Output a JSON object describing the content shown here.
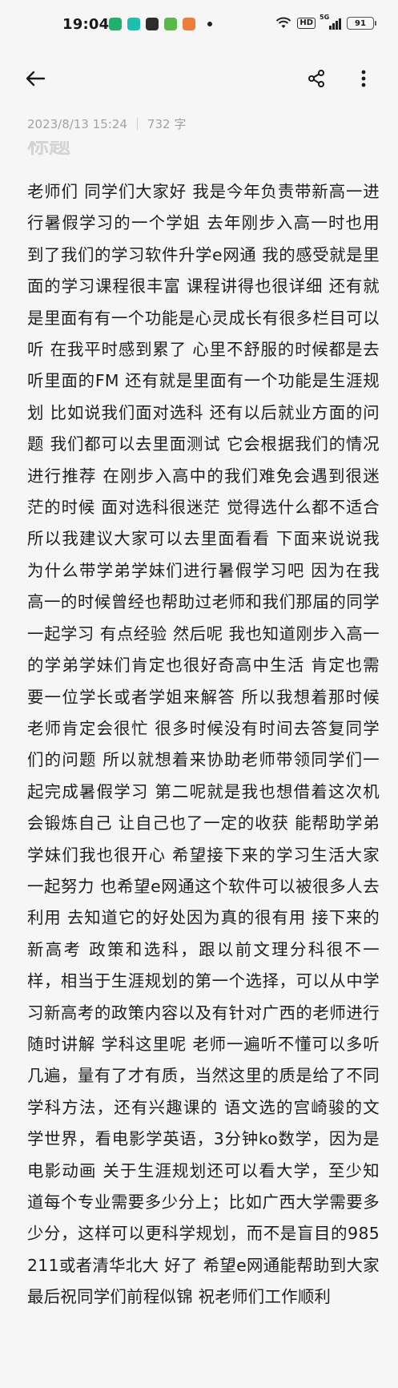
{
  "status_bar": {
    "time": "19:04",
    "signal_label": "5G",
    "hd_label": "HD",
    "battery": "91",
    "app_icon_colors": [
      "#22b06a",
      "#1fbfb0",
      "#2d2d2d",
      "#58b947",
      "#ef7d3a"
    ]
  },
  "toolbar": {
    "back_icon": "arrow-left-icon",
    "share_icon": "share-icon",
    "more_icon": "more-vertical-icon"
  },
  "note": {
    "datetime": "2023/8/13 15:24",
    "word_count": "732 字",
    "title": "标题",
    "body": "老师们 同学们大家好 我是今年负责带新高一进行暑假学习的一个学姐 去年刚步入高一时也用到了我们的学习软件升学e网通 我的感受就是里面的学习课程很丰富 课程讲得也很详细 还有就是里面有有一个功能是心灵成长有很多栏目可以听 在我平时感到累了 心里不舒服的时候都是去听里面的FM 还有就是里面有一个功能是生涯规划 比如说我们面对选科 还有以后就业方面的问题 我们都可以去里面测试 它会根据我们的情况进行推荐 在刚步入高中的我们难免会遇到很迷茫的时候 面对选科很迷茫 觉得选什么都不适合 所以我建议大家可以去里面看看 下面来说说我为什么带学弟学妹们进行暑假学习吧 因为在我高一的时候曾经也帮助过老师和我们那届的同学一起学习 有点经验 然后呢 我也知道刚步入高一的学弟学妹们肯定也很好奇高中生活 肯定也需要一位学长或者学姐来解答 所以我想着那时候老师肯定会很忙 很多时候没有时间去答复同学们的问题 所以就想着来协助老师带领同学们一起完成暑假学习 第二呢就是我也想借着这次机会锻炼自己 让自己也了一定的收获 能帮助学弟学妹们我也很开心 希望接下来的学习生活大家一起努力 也希望e网通这个软件可以被很多人去利用 去知道它的好处因为真的很有用 接下来的新高考 政策和选科，跟以前文理分科很不一样，相当于生涯规划的第一个选择，可以从中学习新高考的政策内容以及有针对广西的老师进行随时讲解 学科这里呢 老师一遍听不懂可以多听几遍，量有了才有质，当然这里的质是给了不同学科方法，还有兴趣课的 语文选的宫崎骏的文学世界，看电影学英语，3分钟ko数学，因为是电影动画 关于生涯规划还可以看大学，至少知道每个专业需要多少分上；比如广西大学需要多少分，这样可以更科学规划，而不是盲目的985211或者清华北大 好了 希望e网通能帮助到大家 最后祝同学们前程似锦 祝老师们工作顺利"
  }
}
